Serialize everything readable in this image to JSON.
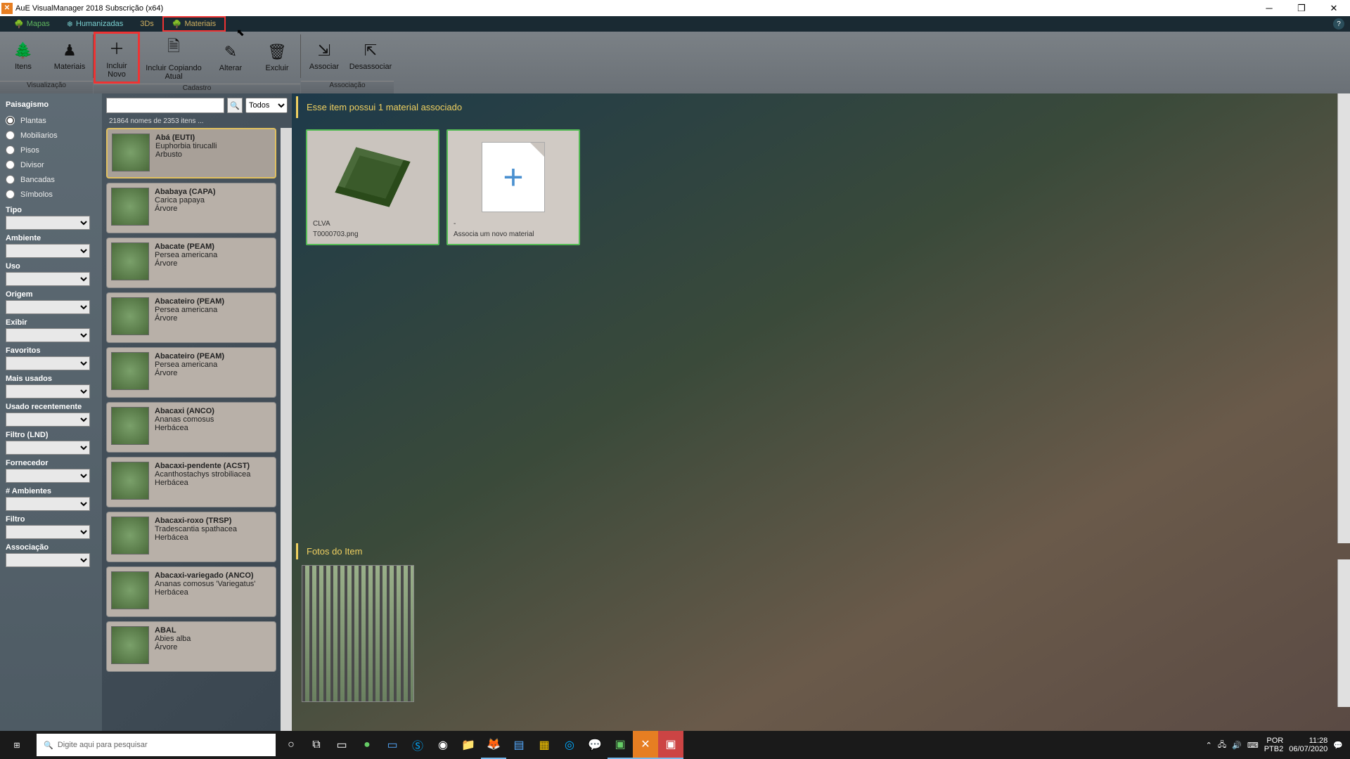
{
  "app": {
    "title": "AuE VisualManager 2018 Subscrição (x64)"
  },
  "tabs": {
    "mapas": "Mapas",
    "humanizadas": "Humanizadas",
    "tds": "3Ds",
    "materiais": "Materiais"
  },
  "ribbon": {
    "itens": "Itens",
    "materiais": "Materiais",
    "incluir_novo": "Incluir Novo",
    "incluir_copiando": "Incluir Copiando Atual",
    "alterar": "Alterar",
    "excluir": "Excluir",
    "associar": "Associar",
    "desassociar": "Desassociar",
    "grp_vis": "Visualização",
    "grp_cad": "Cadastro",
    "grp_assoc": "Associação"
  },
  "sidebar": {
    "header": "Paisagismo",
    "radios": {
      "plantas": "Plantas",
      "mobiliarios": "Mobiliarios",
      "pisos": "Pisos",
      "divisor": "Divisor",
      "bancadas": "Bancadas",
      "simbolos": "Símbolos"
    },
    "filters": {
      "tipo": "Tipo",
      "ambiente": "Ambiente",
      "uso": "Uso",
      "origem": "Origem",
      "exibir": "Exibir",
      "favoritos": "Favoritos",
      "maisusados": "Mais usados",
      "usadorecent": "Usado recentemente",
      "filtrolnd": "Filtro (LND)",
      "fornecedor": "Fornecedor",
      "nambientes": "# Ambientes",
      "filtro": "Filtro",
      "associacao": "Associação"
    }
  },
  "list": {
    "filter_all": "Todos",
    "count": "21864 nomes de 2353 itens ...",
    "items": [
      {
        "name": "Abá (EUTI)",
        "sci": "Euphorbia tirucalli",
        "type": "Arbusto"
      },
      {
        "name": "Ababaya (CAPA)",
        "sci": "Carica papaya",
        "type": "Árvore"
      },
      {
        "name": "Abacate (PEAM)",
        "sci": "Persea americana",
        "type": "Árvore"
      },
      {
        "name": "Abacateiro (PEAM)",
        "sci": "Persea americana",
        "type": "Árvore"
      },
      {
        "name": "Abacateiro (PEAM)",
        "sci": "Persea americana",
        "type": "Árvore"
      },
      {
        "name": "Abacaxi (ANCO)",
        "sci": "Ananas comosus",
        "type": "Herbácea"
      },
      {
        "name": "Abacaxi-pendente (ACST)",
        "sci": "Acanthostachys strobiliacea",
        "type": "Herbácea"
      },
      {
        "name": "Abacaxi-roxo (TRSP)",
        "sci": "Tradescantia spathacea",
        "type": "Herbácea"
      },
      {
        "name": "Abacaxi-variegado (ANCO)",
        "sci": "Ananas comosus 'Variegatus'",
        "type": "Herbácea"
      },
      {
        "name": "ABAL",
        "sci": "Abies alba",
        "type": "Árvore"
      }
    ]
  },
  "content": {
    "header": "Esse item possui  1 material associado",
    "mat_name": "CLVA",
    "mat_file": "T0000703.png",
    "assoc_dash": "-",
    "assoc_text": "Associa um novo material",
    "fotos_header": "Fotos do Item"
  },
  "taskbar": {
    "search_placeholder": "Digite aqui para pesquisar",
    "lang1": "POR",
    "lang2": "PTB2",
    "time": "11:28",
    "date": "06/07/2020"
  }
}
